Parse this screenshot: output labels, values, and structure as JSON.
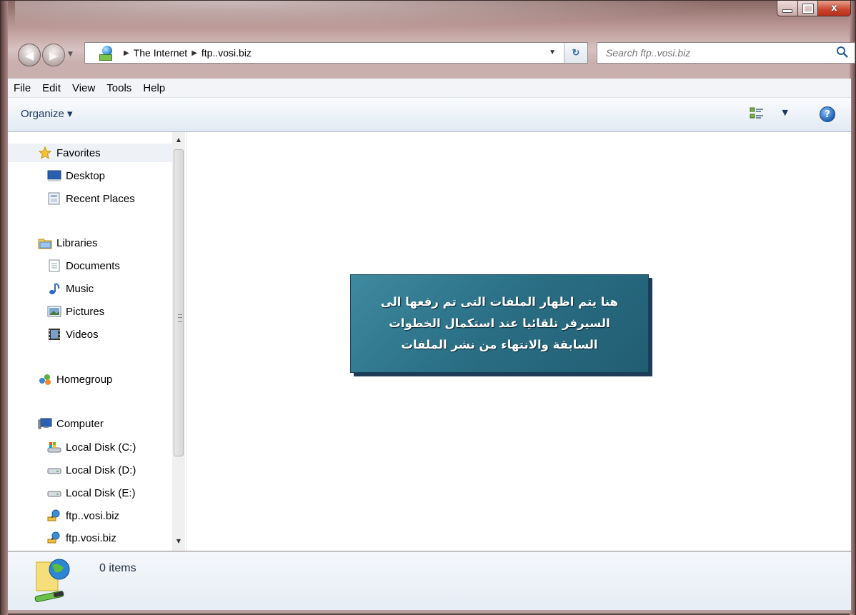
{
  "window": {
    "controls": {
      "minimize": "–",
      "maximize": "□",
      "close": "x"
    }
  },
  "address": {
    "crumbs": [
      "The Internet",
      "ftp..vosi.biz"
    ],
    "icon": "network-globe-icon"
  },
  "search": {
    "placeholder": "Search ftp..vosi.biz"
  },
  "menu": [
    "File",
    "Edit",
    "View",
    "Tools",
    "Help"
  ],
  "toolbar": {
    "organize": "Organize ▾"
  },
  "nav": {
    "favorites": {
      "header": "Favorites",
      "items": [
        "Desktop",
        "Recent Places"
      ]
    },
    "libraries": {
      "header": "Libraries",
      "items": [
        "Documents",
        "Music",
        "Pictures",
        "Videos"
      ]
    },
    "homegroup": "Homegroup",
    "computer": {
      "header": "Computer",
      "items": [
        "Local Disk (C:)",
        "Local Disk (D:)",
        "Local Disk (E:)",
        "ftp..vosi.biz",
        "ftp.vosi.biz"
      ]
    }
  },
  "callout": {
    "lines": [
      "هنا يتم اظهار الملفات التى تم رفعها الى",
      "السيرفر تلقائيا  عند استكمال الخطوات",
      "السابقة والانتهاء من نشر الملفات"
    ]
  },
  "status": {
    "items": "0 items"
  },
  "colors": {
    "callout": "#2b7086",
    "callout_shadow": "#1f3b58",
    "accent": "#1e395b"
  }
}
